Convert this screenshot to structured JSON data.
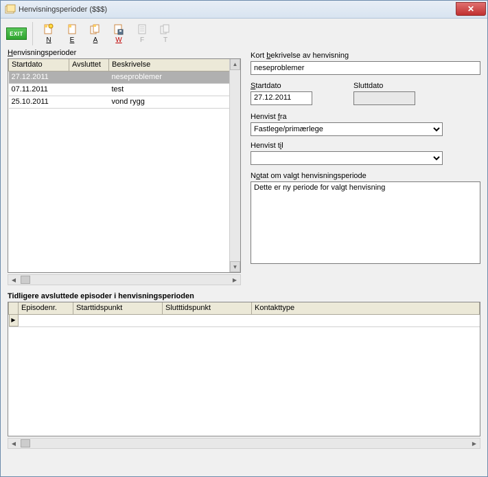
{
  "window": {
    "title": "Henvisningsperioder ($$$)"
  },
  "toolbar": {
    "exit": "EXIT",
    "btn_n": "N",
    "btn_e": "E",
    "btn_a": "A",
    "btn_w": "W",
    "btn_f": "F",
    "btn_t": "T"
  },
  "left": {
    "section_label_pre": "H",
    "section_label_rest": "envisningsperioder",
    "columns": {
      "startdato": "Startdato",
      "avsluttet": "Avsluttet",
      "beskrivelse": "Beskrivelse"
    },
    "rows": [
      {
        "startdato": "27.12.2011",
        "avsluttet": "",
        "beskrivelse": "neseproblemer",
        "selected": true
      },
      {
        "startdato": "07.11.2011",
        "avsluttet": "",
        "beskrivelse": "test",
        "selected": false
      },
      {
        "startdato": "25.10.2011",
        "avsluttet": "",
        "beskrivelse": "vond rygg",
        "selected": false
      }
    ]
  },
  "right": {
    "kort_label_pre": "Kort ",
    "kort_label_ul": "b",
    "kort_label_rest": "ekrivelse av henvisning",
    "kort_value": "neseproblemer",
    "startdato_ul": "S",
    "startdato_rest": "tartdato",
    "startdato_value": "27.12.2011",
    "sluttdato_label": "Sluttdato",
    "sluttdato_value": "",
    "henvistfra_pre": "Henvist ",
    "henvistfra_ul": "f",
    "henvistfra_rest": "ra",
    "henvistfra_value": "Fastlege/primærlege",
    "henvisttil_pre": "Henvist t",
    "henvisttil_ul": "i",
    "henvisttil_rest": "l",
    "henvisttil_value": "",
    "notat_pre": "N",
    "notat_ul": "o",
    "notat_rest": "tat om valgt henvisningsperiode",
    "notat_value": "Dette er ny periode for valgt henvisning"
  },
  "bottom": {
    "heading": "Tidligere avsluttede episoder i henvisningsperioden",
    "columns": {
      "episodenr": "Episodenr.",
      "starttidspunkt": "Starttidspunkt",
      "slutttidspunkt": "Slutttidspunkt",
      "kontakttype": "Kontakttype"
    }
  }
}
